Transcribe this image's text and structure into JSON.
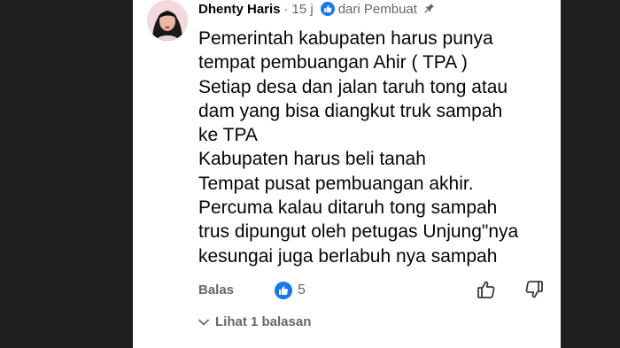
{
  "comment": {
    "author": "Dhenty Haris",
    "separator": "·",
    "time": "15 j",
    "badge": "dari Pembuat",
    "lines": [
      "Pemerintah kabupaten harus punya",
      "tempat pembuangan Ahir ( TPA )",
      "Setiap desa dan jalan taruh tong atau",
      "dam yang bisa diangkut truk sampah",
      "ke TPA",
      "Kabupaten harus beli tanah",
      "Tempat pusat pembuangan akhir.",
      "Percuma kalau ditaruh tong sampah",
      "trus dipungut oleh petugas Unjung\"nya",
      "kesungai juga berlabuh nya sampah"
    ]
  },
  "actions": {
    "reply_label": "Balas",
    "like_count": "5"
  },
  "replies": {
    "view_label": "Lihat 1 balasan"
  },
  "colors": {
    "accent": "#1877f2",
    "secondary_text": "#65676b",
    "primary_text": "#050505"
  },
  "icons": [
    "avatar",
    "like-badge-icon",
    "pin-icon",
    "like-reaction-icon",
    "thumbs-up-icon",
    "thumbs-down-icon",
    "chevron-down-icon"
  ]
}
